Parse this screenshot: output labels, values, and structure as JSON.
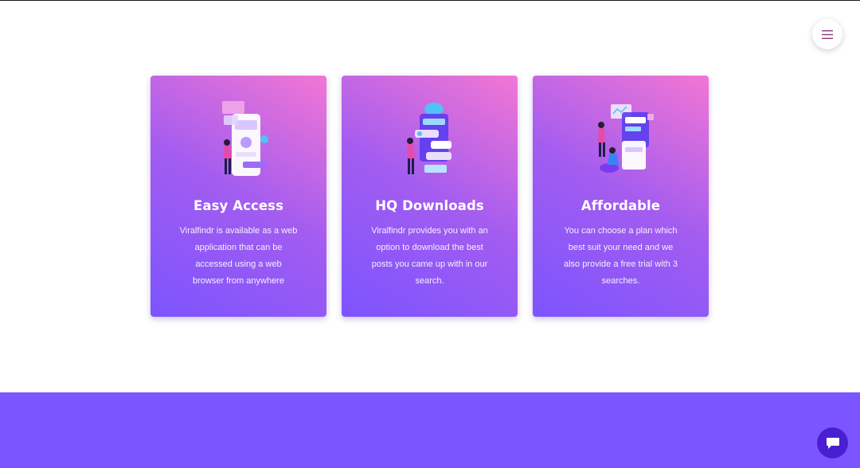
{
  "header": {
    "menu_icon": "hamburger-icon"
  },
  "features": [
    {
      "title": "Easy Access",
      "description": "Viralfindr is available as a web application that can be accessed using a web browser from anywhere",
      "illustration": "person-with-mobile-app-illustration"
    },
    {
      "title": "HQ Downloads",
      "description": "Viralfindr provides you with an option to download the best posts you came up with in our search.",
      "illustration": "person-with-cloud-downloads-illustration"
    },
    {
      "title": "Affordable",
      "description": "You can choose a plan which best suit your need and we also provide a free trial with 3 searches.",
      "illustration": "people-with-dashboard-illustration"
    }
  ],
  "chat": {
    "icon": "chat-bubble-icon"
  },
  "colors": {
    "card_gradient_start": "#7c54ff",
    "card_gradient_end": "#f276d4",
    "footer": "#7b55ff",
    "chat_button": "#4a1fd1",
    "menu_icon": "#8a3a7a"
  }
}
